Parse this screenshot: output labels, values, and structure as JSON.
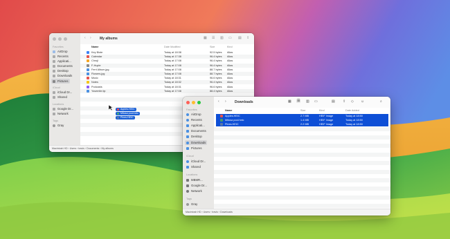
{
  "colors": {
    "accent": "#1a5fd6",
    "selection_row": "#0e4fd6"
  },
  "finder_back": {
    "title": "My albums",
    "sidebar": {
      "favorites_head": "Favorites",
      "favorites": [
        "AirDrop",
        "Recents",
        "Applicati...",
        "Documents",
        "Desktop",
        "Downloads",
        "Pictures"
      ],
      "icloud_head": "iCloud",
      "icloud": [
        "iCloud Dr...",
        "Shared"
      ],
      "locations_head": "Locations",
      "locations": [
        "Google Dr...",
        "Network"
      ],
      "tags_head": "Tags",
      "tags": [
        "Gray"
      ]
    },
    "columns": {
      "name": "Name",
      "date": "Date Modified",
      "size": "Size",
      "kind": "Kind"
    },
    "rows": [
      {
        "name": "Key Biote",
        "date": "Today at 18:38",
        "size": "92.5 bytes",
        "kind": "Alias"
      },
      {
        "name": "Calendar",
        "date": "Today at 17:38",
        "size": "96.4 bytes",
        "kind": "Alias"
      },
      {
        "name": "Chroji",
        "date": "Today at 17:08",
        "size": "96.4 bytes",
        "kind": "Alias"
      },
      {
        "name": "F-Huple",
        "date": "Today at 17:08",
        "size": "96.4 bytes",
        "kind": "Alias"
      },
      {
        "name": "Ferri Album.jpg",
        "date": "Today at 17:08",
        "size": "88.7 bytes",
        "kind": "Alias"
      },
      {
        "name": "Flowers.jpg",
        "date": "Today at 17:08",
        "size": "88.7 bytes",
        "kind": "Alias"
      },
      {
        "name": "Music",
        "date": "Today at 18:31",
        "size": "96.6 bytes",
        "kind": "Alias"
      },
      {
        "name": "Notes",
        "date": "Today at 18:32",
        "size": "96.4 bytes",
        "kind": "Alias"
      },
      {
        "name": "Podcasts",
        "date": "Today at 18:31",
        "size": "96.6 bytes",
        "kind": "Alias"
      },
      {
        "name": "Yosemite.tip",
        "date": "Today at 17:08",
        "size": "88.4 bytes",
        "kind": "Alias"
      }
    ],
    "drag_items": [
      "Apples.HEIC",
      "Mitosa pool.heic",
      "Pines.HEIC"
    ],
    "path": "Macintosh HD › Users › travis › Documents › My albums"
  },
  "finder_front": {
    "title": "Downloads",
    "sidebar": {
      "favorites_head": "Favorites",
      "favorites": [
        "AirDrop",
        "Recents",
        "Applicati...",
        "Documents",
        "Desktop",
        "Downloads",
        "Pictures"
      ],
      "icloud_head": "iCloud",
      "icloud": [
        "iCloud Dr...",
        "Shared"
      ],
      "locations_head": "Locations",
      "locations": [
        "MBMR...",
        "Google Dr...",
        "Network"
      ],
      "tags_head": "Tags",
      "tags": [
        "Gray"
      ]
    },
    "columns": {
      "name": "Name",
      "size": "Size",
      "kind": "Kind",
      "date": "Date Added"
    },
    "rows": [
      {
        "name": "Apples.HEIC",
        "size": "2.7 MB",
        "kind": "HEIF Image",
        "date": "Today at 18:50"
      },
      {
        "name": "Mitosa pool.heic",
        "size": "1.4 MB",
        "kind": "HEIF Image",
        "date": "Today at 18:50"
      },
      {
        "name": "Pines.HEIC",
        "size": "2.2 MB",
        "kind": "HEIF Image",
        "date": "Today at 18:50"
      }
    ],
    "path": "Macintosh HD › Users › travis › Downloads"
  }
}
